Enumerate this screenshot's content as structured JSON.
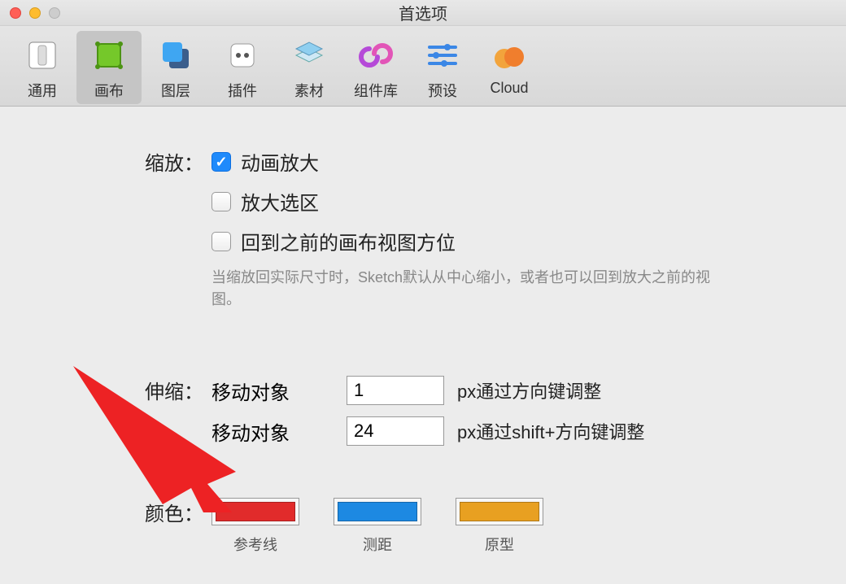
{
  "window": {
    "title": "首选项"
  },
  "toolbar": {
    "items": [
      {
        "label": "通用"
      },
      {
        "label": "画布"
      },
      {
        "label": "图层"
      },
      {
        "label": "插件"
      },
      {
        "label": "素材"
      },
      {
        "label": "组件库"
      },
      {
        "label": "预设"
      },
      {
        "label": "Cloud"
      }
    ],
    "selected_index": 1
  },
  "zoom": {
    "section_label": "缩放：",
    "items": [
      {
        "label": "动画放大",
        "checked": true
      },
      {
        "label": "放大选区",
        "checked": false
      },
      {
        "label": "回到之前的画布视图方位",
        "checked": false
      }
    ],
    "help": "当缩放回实际尺寸时，Sketch默认从中心缩小，或者也可以回到放大之前的视图。"
  },
  "nudge": {
    "section_label": "伸缩：",
    "rows": [
      {
        "label": "移动对象",
        "value": "1",
        "unit": "px通过方向键调整"
      },
      {
        "label": "移动对象",
        "value": "24",
        "unit": "px通过shift+方向键调整"
      }
    ]
  },
  "colors": {
    "section_label": "颜色：",
    "items": [
      {
        "label": "参考线",
        "hex": "#e12b2b"
      },
      {
        "label": "测距",
        "hex": "#1d89e2"
      },
      {
        "label": "原型",
        "hex": "#e8a021"
      }
    ]
  }
}
